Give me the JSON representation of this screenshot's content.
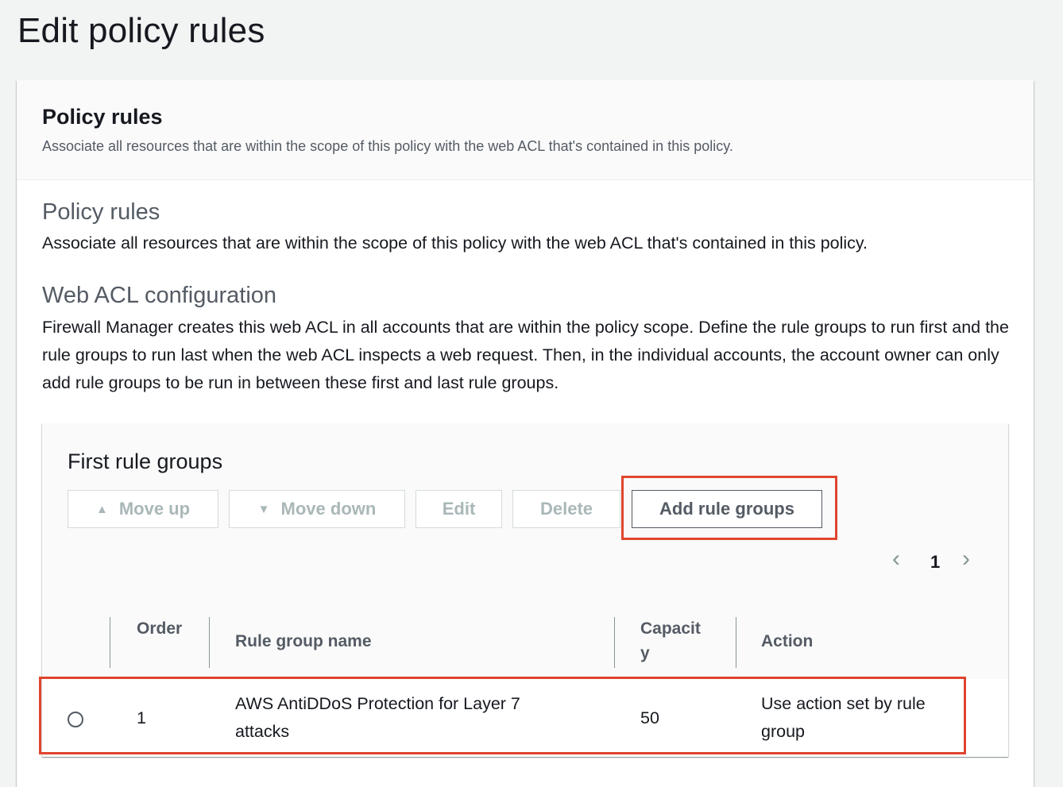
{
  "page": {
    "title": "Edit policy rules"
  },
  "container_header": {
    "title": "Policy rules",
    "description": "Associate all resources that are within the scope of this policy with the web ACL that's contained in this policy."
  },
  "policy_rules": {
    "title": "Policy rules",
    "description": "Associate all resources that are within the scope of this policy with the web ACL that's contained in this policy."
  },
  "web_acl": {
    "title": "Web ACL configuration",
    "description": "Firewall Manager creates this web ACL in all accounts that are within the policy scope. Define the rule groups to run first and the rule groups to run last when the web ACL inspects a web request. Then, in the individual accounts, the account owner can only add rule groups to be run in between these first and last rule groups."
  },
  "first_rule_groups": {
    "title": "First rule groups",
    "buttons": {
      "move_up": "Move up",
      "move_down": "Move down",
      "edit": "Edit",
      "delete": "Delete",
      "add": "Add rule groups"
    },
    "icons": {
      "move_up": "triangle-up-icon",
      "move_down": "triangle-down-icon"
    },
    "pagination": {
      "current_page": "1"
    },
    "columns": {
      "order": "Order",
      "name": "Rule group name",
      "capacity": "Capacity",
      "action": "Action"
    },
    "rows": [
      {
        "order": "1",
        "name": "AWS AntiDDoS Protection for Layer 7 attacks",
        "capacity": "50",
        "action": "Use action set by rule group"
      }
    ]
  },
  "colors": {
    "highlight": "#e0452f",
    "disabled_text": "#aab7b8",
    "primary_text": "#545b64"
  }
}
